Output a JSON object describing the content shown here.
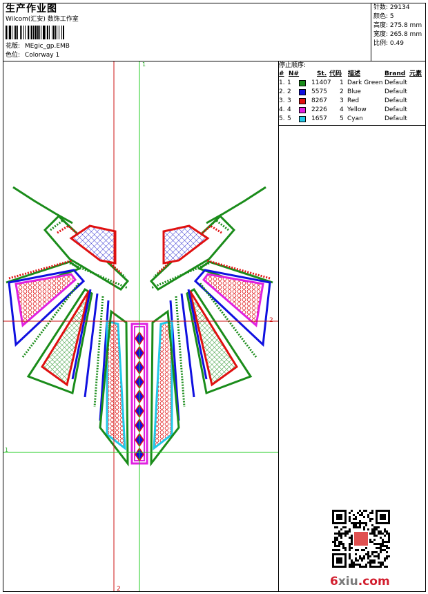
{
  "header": {
    "title": "生产作业图",
    "studio": "Wilcom(汇安) 数饰工作室",
    "design_label": "花版:",
    "design_value": "MEgic_gp.EMB",
    "colorway_label": "色位:",
    "colorway_value": "Colorway 1"
  },
  "specs": [
    {
      "label": "针数:",
      "value": "29134"
    },
    {
      "label": "颜色:",
      "value": "5"
    },
    {
      "label": "高度:",
      "value": "275.8 mm"
    },
    {
      "label": "宽度:",
      "value": "265.8 mm"
    },
    {
      "label": "比例:",
      "value": "0.49"
    }
  ],
  "stop_sequence": {
    "heading": "停止顺序:",
    "columns": [
      "#",
      "N#",
      "St.",
      "代码",
      "描述",
      "Brand",
      "元素"
    ],
    "rows": [
      {
        "idx": "1.",
        "n": "1",
        "st": "11407",
        "code": "1",
        "desc": "Dark Green",
        "brand": "Default",
        "color": "#1a8c1a"
      },
      {
        "idx": "2.",
        "n": "2",
        "st": "5575",
        "code": "2",
        "desc": "Blue",
        "brand": "Default",
        "color": "#1010e0"
      },
      {
        "idx": "3.",
        "n": "3",
        "st": "8267",
        "code": "3",
        "desc": "Red",
        "brand": "Default",
        "color": "#e01010"
      },
      {
        "idx": "4.",
        "n": "4",
        "st": "2226",
        "code": "4",
        "desc": "Yellow",
        "brand": "Default",
        "color": "#e020e0"
      },
      {
        "idx": "5.",
        "n": "5",
        "st": "1657",
        "code": "5",
        "desc": "Cyan",
        "brand": "Default",
        "color": "#20c8e8"
      }
    ]
  },
  "guides": {
    "v1": "1",
    "h2": "2",
    "h1": "1",
    "v2": "2"
  },
  "colors": {
    "green": "#1a8c1a",
    "blue": "#1010e0",
    "red": "#e01010",
    "magenta": "#e020e0",
    "cyan": "#20c8e8",
    "guide_green": "#22cc22",
    "guide_red": "#cc1111"
  },
  "watermark": {
    "site_prefix": "6",
    "site_main": "xiu",
    "site_suffix": ".com"
  }
}
